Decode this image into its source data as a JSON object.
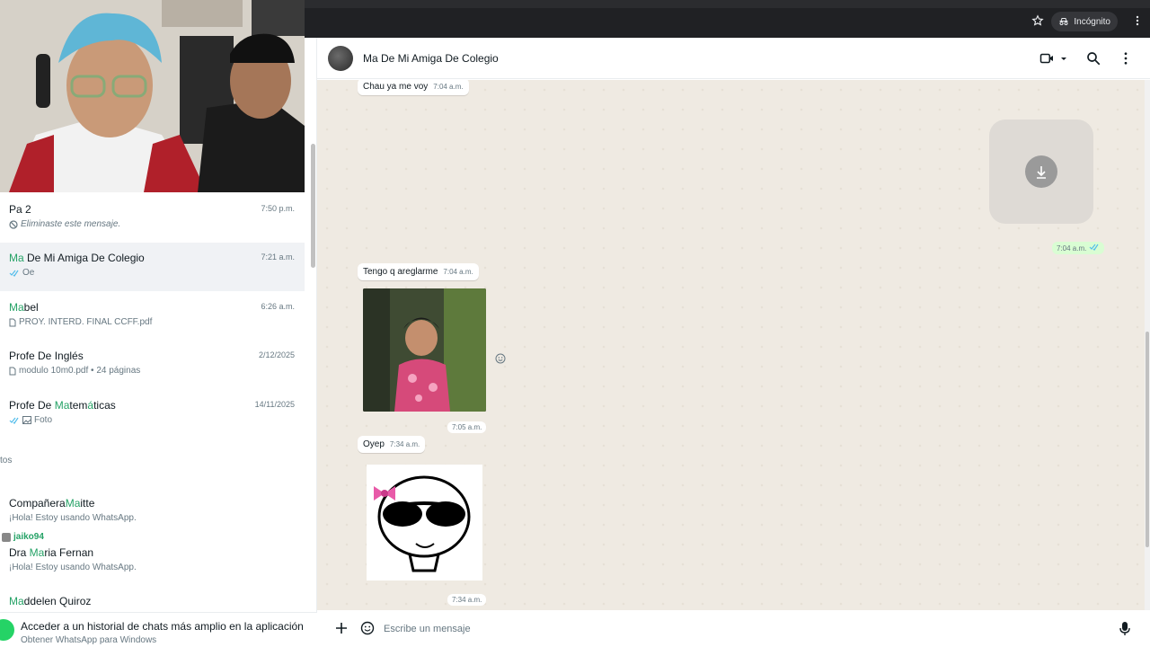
{
  "browser": {
    "incognito_label": "Incógnito"
  },
  "chat_list": [
    {
      "name_plain": "Pa 2",
      "time": "7:50 p.m.",
      "preview": "Eliminaste este mensaje."
    },
    {
      "name_hl": "Ma",
      "name_rest": " De Mi Amiga De Colegio",
      "time": "7:21 a.m.",
      "preview": "Oe"
    },
    {
      "name_hl": "Ma",
      "name_rest": "bel",
      "time": "6:26 a.m.",
      "preview": "PROY. INTERD. FINAL CCFF.pdf"
    },
    {
      "name_plain": "Profe De Inglés",
      "time": "2/12/2025",
      "preview": "modulo 10m0.pdf • 24 páginas"
    },
    {
      "name_pre": "Profe De ",
      "name_hl": "Ma",
      "name_mid": "tem",
      "name_hl2": "á",
      "name_rest": "ticas",
      "time": "14/11/2025",
      "preview": "Foto"
    }
  ],
  "contacts_label": "tos",
  "contacts": [
    {
      "name_pre": "Compañera",
      "name_hl": "Ma",
      "name_rest": "itte",
      "status": "¡Hola! Estoy usando WhatsApp."
    },
    {
      "name_pre": "Dra ",
      "name_hl": "Ma",
      "name_rest": "ria Fernan",
      "status": "¡Hola! Estoy usando WhatsApp."
    },
    {
      "name_hl": "Ma",
      "name_rest": "ddelen Quiroz"
    }
  ],
  "overlay_user": "jaiko94",
  "promo": {
    "title": "Acceder a un historial de chats más amplio en la aplicación",
    "subtitle": "Obtener WhatsApp para Windows"
  },
  "chat": {
    "title": "Ma De Mi Amiga De Colegio",
    "composer_placeholder": "Escribe un mensaje",
    "messages": [
      {
        "text": "Chau  ya me voy",
        "time": "7:04 a.m."
      },
      {
        "time_out": "7:04 a.m."
      },
      {
        "text": "Tengo q areglarme",
        "time": "7:04 a.m."
      },
      {
        "time_photo": "7:05 a.m."
      },
      {
        "text": "Oyep",
        "time": "7:34 a.m."
      },
      {
        "time_sticker": "7:34 a.m."
      }
    ]
  },
  "colors": {
    "accent": "#25a266",
    "chat_bg": "#efeae2",
    "outgoing": "#d9fdd3",
    "check_blue": "#53bdeb"
  }
}
